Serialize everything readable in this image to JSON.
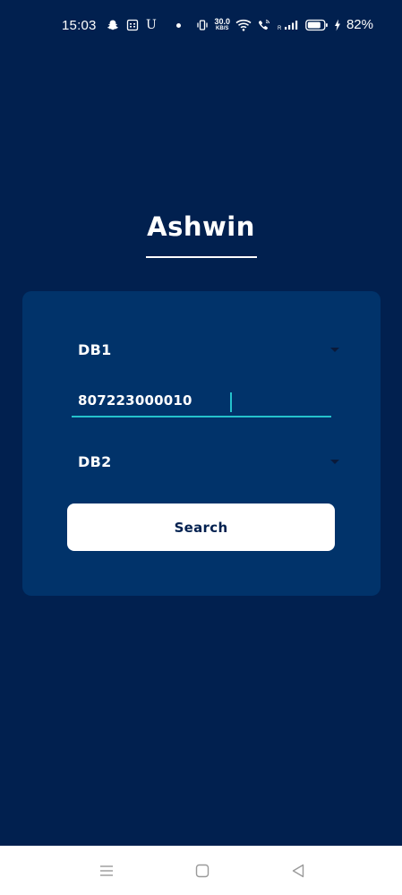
{
  "status_bar": {
    "time": "15:03",
    "u_label": "U",
    "speed_value": "30.0",
    "speed_unit": "KB/S",
    "signal_label": "R",
    "battery_percent": "82%",
    "icons": [
      "snapchat-icon",
      "calendar-icon",
      "vibrate-icon",
      "wifi-icon",
      "wifi-call-icon",
      "signal-icon",
      "battery-icon",
      "charging-icon"
    ]
  },
  "app": {
    "title": "Ashwin"
  },
  "form": {
    "dropdown1": {
      "selected": "DB1"
    },
    "number_input": {
      "value": "807223000010"
    },
    "dropdown2": {
      "selected": "DB2"
    },
    "search_label": "Search"
  },
  "nav_bar": {
    "icons": [
      "menu-icon",
      "home-icon",
      "back-icon"
    ]
  },
  "colors": {
    "background": "#01204f",
    "card": "#01336a",
    "accent": "#25c2cb",
    "button": "#ffffff"
  }
}
